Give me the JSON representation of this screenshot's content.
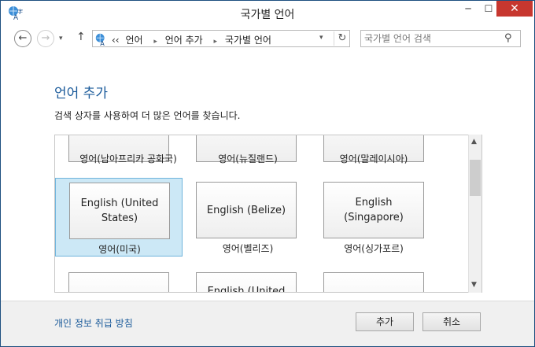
{
  "window": {
    "title": "국가별 언어",
    "min": "─",
    "max": "☐",
    "close": "✕"
  },
  "nav": {
    "back": "←",
    "forward": "→",
    "recent": "▾",
    "up": "↑",
    "crumbs": [
      "‹‹",
      "언어",
      "언어 추가",
      "국가별 언어"
    ],
    "crumb_sep": "▸",
    "dropdown": "▾",
    "refresh": "↻",
    "search_placeholder": "국가별 언어 검색",
    "search_icon": "⚲"
  },
  "main": {
    "heading": "언어 추가",
    "description": "검색 상자를 사용하여 더 많은 언어를 찾습니다."
  },
  "tiles": [
    {
      "name": "",
      "label": "영어(남아프리카 공화국)"
    },
    {
      "name": "",
      "label": "영어(뉴질랜드)"
    },
    {
      "name": "",
      "label": "영어(말레이시아)"
    },
    {
      "name": "English (United States)",
      "label": "영어(미국)",
      "selected": true
    },
    {
      "name": "English (Belize)",
      "label": "영어(벨리즈)"
    },
    {
      "name": "English (Singapore)",
      "label": "영어(싱가포르)"
    },
    {
      "name": "",
      "label": ""
    },
    {
      "name": "English (United",
      "label": ""
    },
    {
      "name": "",
      "label": ""
    }
  ],
  "scrollbar": {
    "up": "▲",
    "down": "▼"
  },
  "footer": {
    "privacy": "개인 정보 취급 방침",
    "add": "추가",
    "cancel": "취소"
  }
}
